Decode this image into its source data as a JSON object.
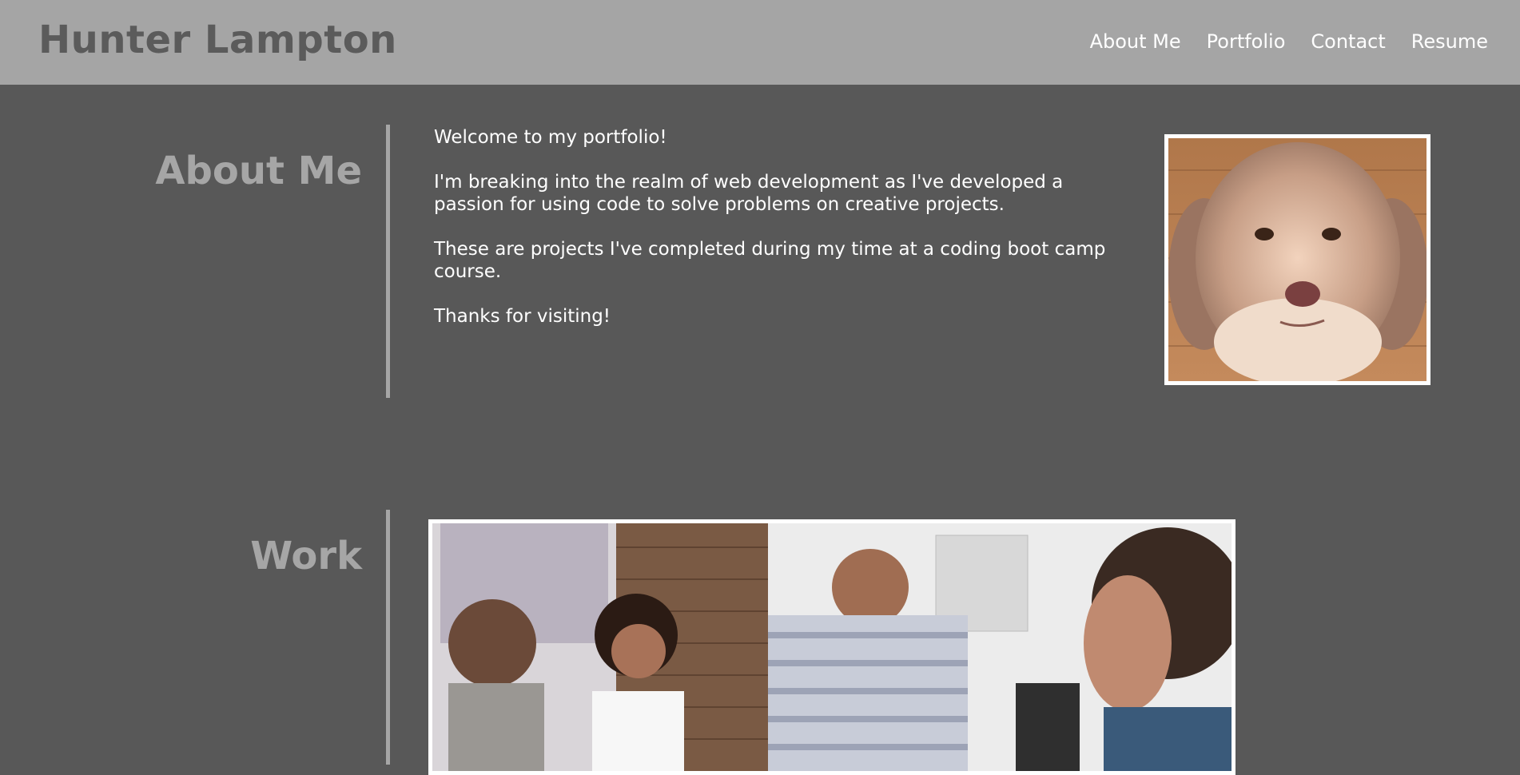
{
  "header": {
    "title": "Hunter Lampton",
    "nav": [
      "About Me",
      "Portfolio",
      "Contact",
      "Resume"
    ]
  },
  "about": {
    "heading": "About Me",
    "paragraphs": [
      "Welcome to my portfolio!",
      "I'm breaking into the realm of web development as I've developed a passion for using code to solve problems on creative projects.",
      "These are projects I've completed during my time at a coding boot camp course.",
      "Thanks for visiting!"
    ]
  },
  "work": {
    "heading": "Work"
  },
  "colors": {
    "page_background": "#585858",
    "header_background": "#a5a5a5",
    "title_text": "#5b5b5b",
    "heading_text": "#a6a6a6",
    "body_text": "#ffffff"
  }
}
